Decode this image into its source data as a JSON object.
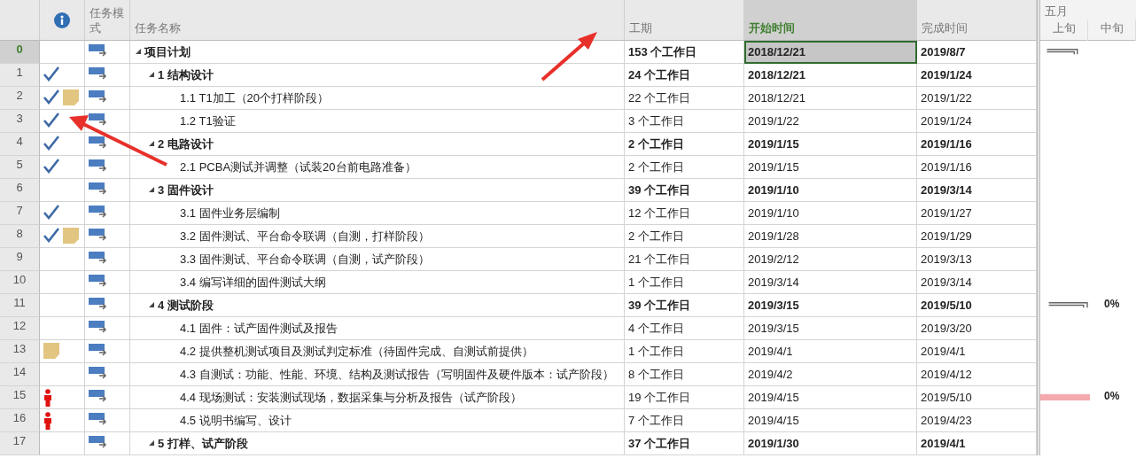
{
  "columns": [
    {
      "kind": "indicators",
      "selected": false
    },
    {
      "kind": "mode",
      "label": "任务模式",
      "selected": false
    },
    {
      "kind": "name",
      "label": "任务名称",
      "selected": false
    },
    {
      "kind": "duration",
      "label": "工期",
      "selected": false
    },
    {
      "kind": "start",
      "label": "开始时间",
      "selected": true
    },
    {
      "kind": "finish",
      "label": "完成时间",
      "selected": false
    }
  ],
  "timescale": {
    "month": "五月",
    "periods": [
      "上旬",
      "中旬"
    ]
  },
  "tasks": [
    {
      "id": "0",
      "name": "项目计划",
      "duration": "153 个工作日",
      "start": "2018/12/21",
      "finish": "2019/8/7",
      "summary": true,
      "expanded": true,
      "selected": true,
      "complete": false,
      "note": false,
      "overallocated": false,
      "gantt_bar": {
        "kind": "summary"
      },
      "children": [
        {
          "id": "1",
          "name": "1 结构设计",
          "duration": "24 个工作日",
          "start": "2018/12/21",
          "finish": "2019/1/24",
          "summary": true,
          "expanded": true,
          "selected": false,
          "complete": true,
          "note": false,
          "overallocated": false,
          "children": [
            {
              "id": "2",
              "name": "1.1 T1加工（20个打样阶段）",
              "duration": "22 个工作日",
              "start": "2018/12/21",
              "finish": "2019/1/22",
              "summary": false,
              "expanded": false,
              "selected": false,
              "complete": true,
              "note": true,
              "overallocated": false
            },
            {
              "id": "3",
              "name": "1.2 T1验证",
              "duration": "3 个工作日",
              "start": "2019/1/22",
              "finish": "2019/1/24",
              "summary": false,
              "expanded": false,
              "selected": false,
              "complete": true,
              "note": false,
              "overallocated": false
            }
          ]
        },
        {
          "id": "4",
          "name": "2 电路设计",
          "duration": "2 个工作日",
          "start": "2019/1/15",
          "finish": "2019/1/16",
          "summary": true,
          "expanded": true,
          "selected": false,
          "complete": true,
          "note": false,
          "overallocated": false,
          "children": [
            {
              "id": "5",
              "name": "2.1 PCBA测试并调整（试装20台前电路准备）",
              "duration": "2 个工作日",
              "start": "2019/1/15",
              "finish": "2019/1/16",
              "summary": false,
              "expanded": false,
              "selected": false,
              "complete": true,
              "note": false,
              "overallocated": false
            }
          ]
        },
        {
          "id": "6",
          "name": "3 固件设计",
          "duration": "39 个工作日",
          "start": "2019/1/10",
          "finish": "2019/3/14",
          "summary": true,
          "expanded": true,
          "selected": false,
          "complete": false,
          "note": false,
          "overallocated": false,
          "children": [
            {
              "id": "7",
              "name": "3.1 固件业务层编制",
              "duration": "12 个工作日",
              "start": "2019/1/10",
              "finish": "2019/1/27",
              "summary": false,
              "expanded": false,
              "selected": false,
              "complete": true,
              "note": false,
              "overallocated": false
            },
            {
              "id": "8",
              "name": "3.2 固件测试、平台命令联调（自测，打样阶段）",
              "duration": "2 个工作日",
              "start": "2019/1/28",
              "finish": "2019/1/29",
              "summary": false,
              "expanded": false,
              "selected": false,
              "complete": true,
              "note": true,
              "overallocated": false
            },
            {
              "id": "9",
              "name": "3.3 固件测试、平台命令联调（自测，试产阶段）",
              "duration": "21 个工作日",
              "start": "2019/2/12",
              "finish": "2019/3/13",
              "summary": false,
              "expanded": false,
              "selected": false,
              "complete": false,
              "note": false,
              "overallocated": false
            },
            {
              "id": "10",
              "name": "3.4 编写详细的固件测试大纲",
              "duration": "1 个工作日",
              "start": "2019/3/14",
              "finish": "2019/3/14",
              "summary": false,
              "expanded": false,
              "selected": false,
              "complete": false,
              "note": false,
              "overallocated": false
            }
          ]
        },
        {
          "id": "11",
          "name": "4 测试阶段",
          "duration": "39 个工作日",
          "start": "2019/3/15",
          "finish": "2019/5/10",
          "summary": true,
          "expanded": true,
          "selected": false,
          "complete": false,
          "note": false,
          "overallocated": false,
          "gantt_bar": {
            "kind": "summary",
            "label": "0%"
          },
          "children": [
            {
              "id": "12",
              "name": "4.1 固件：试产固件测试及报告",
              "duration": "4 个工作日",
              "start": "2019/3/15",
              "finish": "2019/3/20",
              "summary": false,
              "expanded": false,
              "selected": false,
              "complete": false,
              "note": false,
              "overallocated": false
            },
            {
              "id": "13",
              "name": "4.2 提供整机测试项目及测试判定标准（待固件完成、自测试前提供）",
              "duration": "1 个工作日",
              "start": "2019/4/1",
              "finish": "2019/4/1",
              "summary": false,
              "expanded": false,
              "selected": false,
              "complete": false,
              "note": true,
              "overallocated": false
            },
            {
              "id": "14",
              "name": "4.3 自测试：功能、性能、环境、结构及测试报告（写明固件及硬件版本：试产阶段）",
              "duration": "8 个工作日",
              "start": "2019/4/2",
              "finish": "2019/4/12",
              "summary": false,
              "expanded": false,
              "selected": false,
              "complete": false,
              "note": false,
              "overallocated": false
            },
            {
              "id": "15",
              "name": "4.4 现场测试：安装测试现场，数据采集与分析及报告（试产阶段）",
              "duration": "19 个工作日",
              "start": "2019/4/15",
              "finish": "2019/5/10",
              "summary": false,
              "expanded": false,
              "selected": false,
              "complete": false,
              "note": false,
              "overallocated": true,
              "gantt_bar": {
                "kind": "task",
                "label": "0%"
              }
            },
            {
              "id": "16",
              "name": "4.5 说明书编写、设计",
              "duration": "7 个工作日",
              "start": "2019/4/15",
              "finish": "2019/4/23",
              "summary": false,
              "expanded": false,
              "selected": false,
              "complete": false,
              "note": false,
              "overallocated": true
            }
          ]
        },
        {
          "id": "17",
          "name": "5 打样、试产阶段",
          "duration": "37 个工作日",
          "start": "2019/1/30",
          "finish": "2019/4/1",
          "summary": true,
          "expanded": true,
          "selected": false,
          "complete": false,
          "note": false,
          "overallocated": false
        }
      ]
    }
  ]
}
